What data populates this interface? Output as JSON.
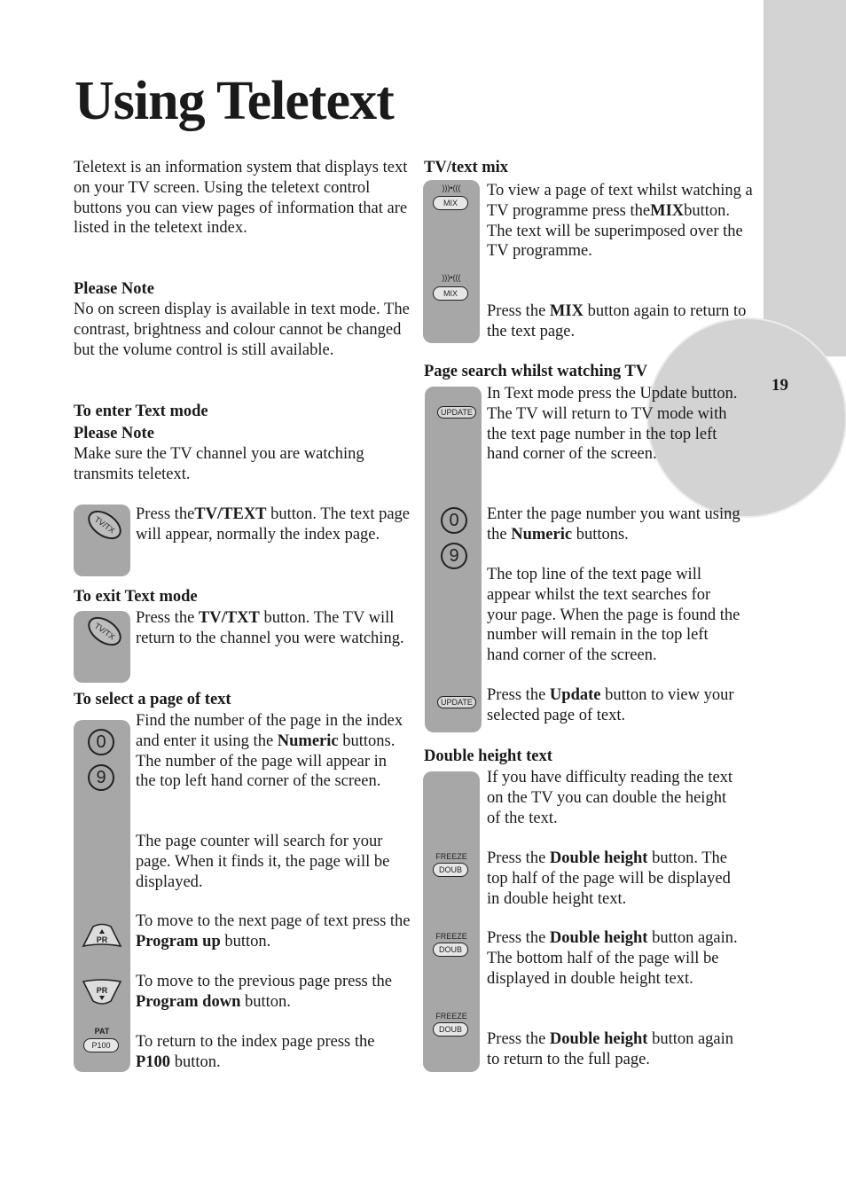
{
  "page": {
    "title": "Using Teletext",
    "page_number": "19"
  },
  "left": {
    "intro": "Teletext is an information system that displays text on your TV screen.  Using the teletext control buttons you can view pages of information that are listed in the  teletext index.",
    "note1_heading": "Please Note",
    "note1_text": "No on screen display is available in text mode. The contrast, brightness and colour cannot be changed but the volume control is still available.",
    "enter_heading": "To enter Text mode",
    "note2_heading": "Please Note",
    "note2_text": "Make sure the TV channel you are watching transmits teletext.",
    "enter_step": {
      "pre": "Press the",
      "bold": "TV/TEXT",
      "post": " button.  The text page will appear, normally the index page."
    },
    "exit_heading": "To exit Text mode",
    "exit_step": {
      "pre": "Press the ",
      "bold": "TV/TXT",
      "post": " button.  The TV will return to the channel you were watching."
    },
    "select_heading": "To select a page of text",
    "select_step1": {
      "pre": "Find the number of the page in the index and enter it using the ",
      "bold": "Numeric",
      "post": "  buttons.  The number of the page will appear in the top left hand corner of the screen."
    },
    "select_step2": "The page counter will search for your page.  When it finds it, the page will be displayed.",
    "select_step3": {
      "pre": "To move to the next page of text press the ",
      "bold": "Program up",
      "post": " button."
    },
    "select_step4": {
      "pre": "To move to the previous page press the  ",
      "bold": "Program down",
      "post": "  button."
    },
    "select_step5": {
      "pre": "To return to the index page press the ",
      "bold": "P100",
      "post": "  button."
    }
  },
  "right": {
    "mix_heading": "TV/text mix",
    "mix_step1": {
      "pre": "To view a page of text whilst watching a TV programme press the",
      "bold": "MIX",
      "post": "button.  The text will be superimposed over the TV programme."
    },
    "mix_step2": {
      "pre": "Press the ",
      "bold": "MIX",
      "post": " button again to return to the text page."
    },
    "search_heading": "Page search whilst watching TV",
    "search_step1": "In Text mode press the Update button.  The TV will return to TV mode with the text page number in the top left hand corner of the screen.",
    "search_step2": {
      "pre": "Enter the page number you want using the ",
      "bold": "Numeric",
      "post": " buttons."
    },
    "search_step3": "The top line of the text page will appear whilst the text searches for your page.  When the page is found the number will remain in the top left hand corner of the screen.",
    "search_step4": {
      "pre": "Press the  ",
      "bold": "Update",
      "post": " button to view your selected page of text."
    },
    "double_heading": "Double height text",
    "double_step1": "If you have difficulty reading the text on the TV you can double the height of the text.",
    "double_step2": {
      "pre": "Press the  ",
      "bold": "Double height",
      "post": "  button. The top half of the page will be displayed in double height text."
    },
    "double_step3": {
      "pre": "Press the ",
      "bold": "Double height",
      "post": "  button again.  The bottom half of the page will be displayed in double height text."
    },
    "double_step4": {
      "pre": "Press the ",
      "bold": "Double height",
      "post": "  button again to return to the full page."
    }
  },
  "icons": {
    "tvtx_label": "TV/TX",
    "zero": "0",
    "nine": "9",
    "pr_label": "PR",
    "pat_label": "PAT",
    "p100_label": "P100",
    "mix_label": "MIX",
    "mix_waves": ")))•(((",
    "update_label": "UPDATE",
    "freeze_label": "FREEZE",
    "doub_label": "DOUB"
  }
}
